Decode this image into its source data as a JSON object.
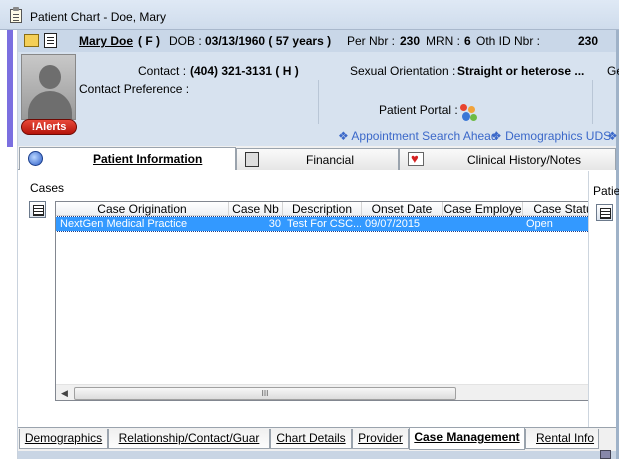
{
  "window": {
    "title": "Patient Chart - Doe, Mary",
    "icon": "clipboard-icon"
  },
  "header": {
    "patient_name": "Mary Doe",
    "sex": "( F )",
    "dob_label": "DOB :",
    "dob_value": "03/13/1960 ( 57 years )",
    "per_nbr_label": "Per Nbr :",
    "per_nbr_value": "230",
    "mrn_label": "MRN :",
    "mrn_value": "6",
    "oth_id_label": "Oth ID Nbr :",
    "oth_id_value": "230",
    "contact_label": "Contact :",
    "contact_value": "(404) 321-3131 ( H )",
    "orientation_label": "Sexual Orientation :",
    "orientation_value": "Straight or heterose ...",
    "orientation_clip": "Ge",
    "contact_pref_label": "Contact Preference :",
    "portal_label": "Patient Portal :",
    "alerts_label": "!Alerts",
    "link_appointment": "❖ Appointment Search Ahead",
    "link_demographics": "❖ Demographics UDS",
    "link_clip": "❖"
  },
  "main_tabs": [
    {
      "label": "Patient Information",
      "icon": "globe-icon",
      "active": true
    },
    {
      "label": "Financial",
      "icon": "calculator-icon",
      "active": false
    },
    {
      "label": "Clinical History/Notes",
      "icon": "heart-monitor-icon",
      "active": false
    }
  ],
  "cases": {
    "label": "Cases",
    "side_label_clip": "Patien",
    "columns": [
      "Case Origination",
      "Case Nb",
      "Description",
      "Onset Date",
      "Case Employe",
      "Case Statu"
    ],
    "rows": [
      {
        "case_origination": "NextGen Medical Practice",
        "case_nb": "30",
        "description": "Test For CSC...",
        "onset_date": "09/07/2015",
        "case_employer": "",
        "case_status": "Open"
      }
    ],
    "scroll_thumb_glyph": "III"
  },
  "bottom_tabs": [
    {
      "label": "Demographics",
      "active": false
    },
    {
      "label": "Relationship/Contact/Guar",
      "active": false
    },
    {
      "label": "Chart Details",
      "active": false
    },
    {
      "label": "Provider",
      "active": false
    },
    {
      "label": "Case Management",
      "active": true
    },
    {
      "label": "Rental Info",
      "active": false
    }
  ],
  "colors": {
    "accent": "#7b6fe0",
    "selection": "#3399ff",
    "link": "#3b68c9",
    "alert": "#c41f12"
  }
}
